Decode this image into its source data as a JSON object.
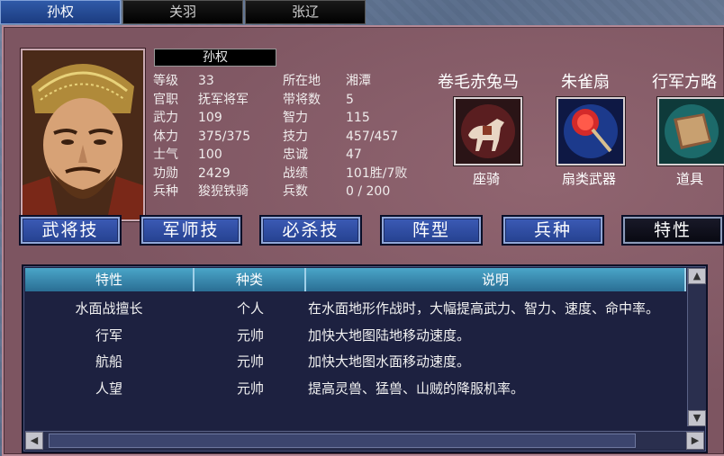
{
  "tabs": [
    {
      "label": "孙权",
      "active": true
    },
    {
      "label": "关羽",
      "active": false
    },
    {
      "label": "张辽",
      "active": false
    }
  ],
  "general": {
    "name": "孙权",
    "stats": [
      {
        "l1": "等级",
        "v1": "33",
        "l2": "所在地",
        "v2": "湘潭"
      },
      {
        "l1": "官职",
        "v1": "抚军将军",
        "l2": "带将数",
        "v2": "5"
      },
      {
        "l1": "武力",
        "v1": "109",
        "l2": "智力",
        "v2": "115"
      },
      {
        "l1": "体力",
        "v1": "375/375",
        "l2": "技力",
        "v2": "457/457"
      },
      {
        "l1": "士气",
        "v1": "100",
        "l2": "忠诚",
        "v2": "47"
      },
      {
        "l1": "功勋",
        "v1": "2429",
        "l2": "战绩",
        "v2": "101胜/7败"
      },
      {
        "l1": "兵种",
        "v1": "狻猊铁骑",
        "l2": "兵数",
        "v2": "0 / 200"
      }
    ]
  },
  "equipment": [
    {
      "name": "卷毛赤兔马",
      "caption": "座骑",
      "icon": "horse-icon"
    },
    {
      "name": "朱雀扇",
      "caption": "扇类武器",
      "icon": "feather-fan-icon"
    },
    {
      "name": "行军方略",
      "caption": "道具",
      "icon": "book-icon"
    }
  ],
  "buttons": [
    {
      "label": "武将技",
      "active": false
    },
    {
      "label": "军师技",
      "active": false
    },
    {
      "label": "必杀技",
      "active": false
    },
    {
      "label": "阵型",
      "active": false
    },
    {
      "label": "兵种",
      "active": false
    },
    {
      "label": "特性",
      "active": true
    }
  ],
  "traits_table": {
    "headers": [
      "特性",
      "种类",
      "说明"
    ],
    "rows": [
      {
        "trait": "水面战擅长",
        "kind": "个人",
        "desc": "在水面地形作战时，大幅提高武力、智力、速度、命中率。"
      },
      {
        "trait": "行军",
        "kind": "元帅",
        "desc": "加快大地图陆地移动速度。"
      },
      {
        "trait": "航船",
        "kind": "元帅",
        "desc": "加快大地图水面移动速度。"
      },
      {
        "trait": "人望",
        "kind": "元帅",
        "desc": "提高灵兽、猛兽、山贼的降服机率。"
      }
    ]
  }
}
